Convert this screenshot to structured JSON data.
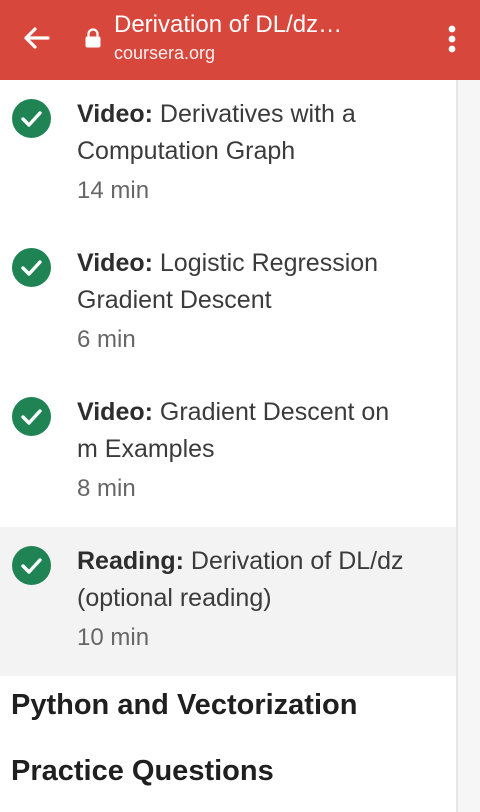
{
  "browser": {
    "title": "Derivation of DL/dz…",
    "url": "coursera.org",
    "colors": {
      "toolbar": "#d8473c"
    }
  },
  "items": [
    {
      "type": "Video:",
      "title": "Derivatives with a Computation Graph",
      "duration": "14 min",
      "completed": true
    },
    {
      "type": "Video:",
      "title": "Logistic Regression Gradient Descent",
      "duration": "6 min",
      "completed": true
    },
    {
      "type": "Video:",
      "title": "Gradient Descent on m Examples",
      "duration": "8 min",
      "completed": true
    },
    {
      "type": "Reading:",
      "title": "Derivation of DL/dz (optional reading)",
      "duration": "10 min",
      "completed": true,
      "current": true
    }
  ],
  "sections": [
    {
      "title": "Python and Vectorization"
    },
    {
      "title": "Practice Questions"
    }
  ],
  "icons": {
    "back": "arrow-left-icon",
    "lock": "lock-icon",
    "menu": "more-vert-icon",
    "check": "check-circle-icon"
  },
  "colors": {
    "check": "#1f8354",
    "highlight_row": "#f3f3f3"
  }
}
